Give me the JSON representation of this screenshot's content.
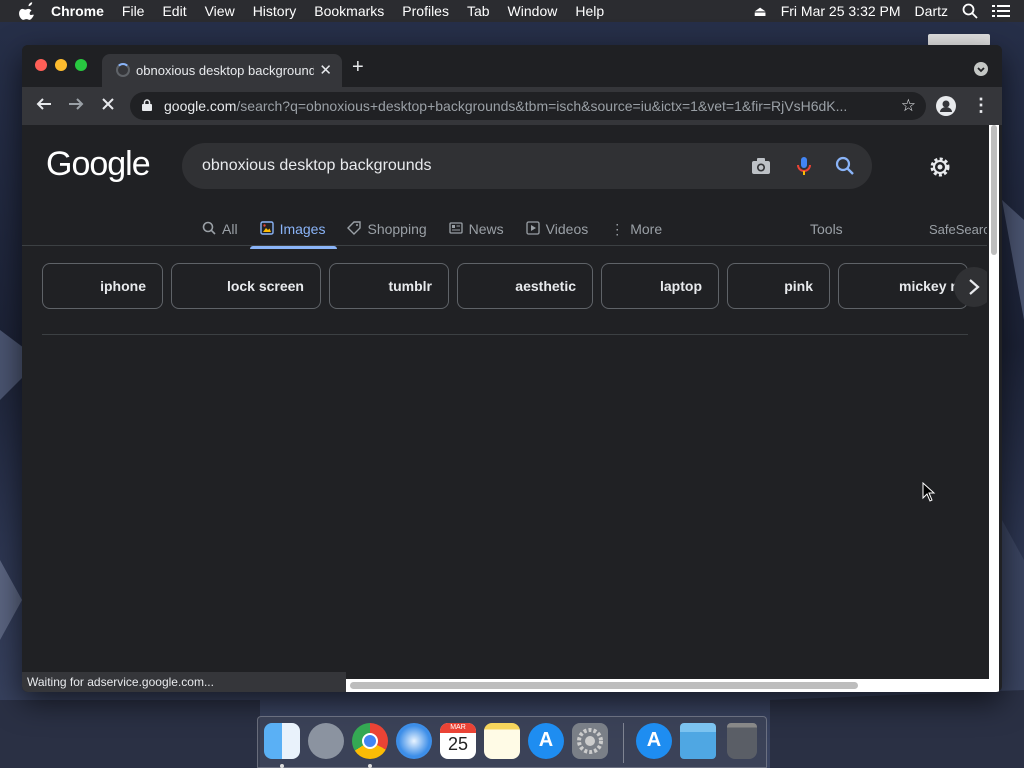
{
  "menubar": {
    "app": "Chrome",
    "items": [
      "File",
      "Edit",
      "View",
      "History",
      "Bookmarks",
      "Profiles",
      "Tab",
      "Window",
      "Help"
    ],
    "datetime": "Fri Mar 25  3:32 PM",
    "user": "Dartz"
  },
  "browser": {
    "tab_title": "obnoxious desktop background",
    "url_host": "google.com",
    "url_path": "/search?q=obnoxious+desktop+backgrounds&tbm=isch&source=iu&ictx=1&vet=1&fir=RjVsH6dK...",
    "status_text": "Waiting for adservice.google.com..."
  },
  "google": {
    "logo": "Google",
    "query": "obnoxious desktop backgrounds",
    "tabs": [
      {
        "label": "All",
        "icon": "search-icon"
      },
      {
        "label": "Images",
        "icon": "image-icon"
      },
      {
        "label": "Shopping",
        "icon": "tag-icon"
      },
      {
        "label": "News",
        "icon": "news-icon"
      },
      {
        "label": "Videos",
        "icon": "video-icon"
      },
      {
        "label": "More",
        "icon": "more-vert-icon"
      }
    ],
    "tools": "Tools",
    "safesearch": "SafeSearch",
    "chips": [
      "iphone",
      "lock screen",
      "tumblr",
      "aesthetic",
      "laptop",
      "pink",
      "mickey r"
    ]
  },
  "colors": {
    "accent": "#8ab4f8",
    "page_bg": "#202124",
    "chrome_toolbar": "#35363a"
  },
  "dock": {
    "apps": [
      "finder-icon",
      "launchpad-icon",
      "chrome-icon",
      "safari-icon",
      "calendar-icon",
      "notes-icon",
      "app-store-icon",
      "system-preferences-icon",
      "app-store-icon",
      "downloads-folder-icon",
      "trash-icon"
    ],
    "calendar_month": "MAR",
    "calendar_day": "25"
  }
}
